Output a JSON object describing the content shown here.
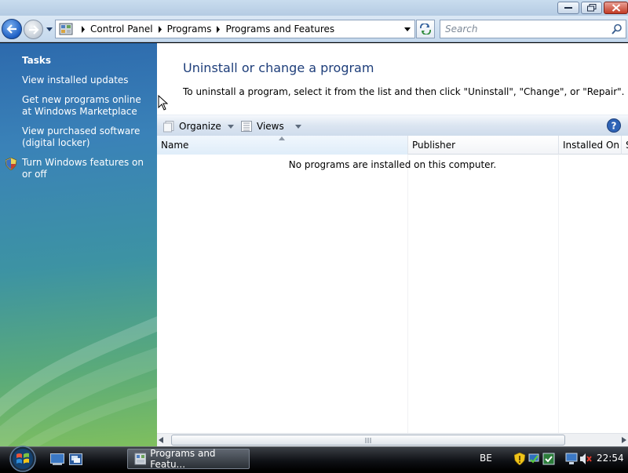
{
  "address_bar": {
    "breadcrumbs": [
      "Control Panel",
      "Programs",
      "Programs and Features"
    ],
    "search_placeholder": "Search"
  },
  "task_pane": {
    "heading": "Tasks",
    "links": [
      "View installed updates",
      "Get new programs online at Windows Marketplace",
      "View purchased software (digital locker)",
      "Turn Windows features on or off"
    ]
  },
  "main": {
    "title": "Uninstall or change a program",
    "description": "To uninstall a program, select it from the list and then click \"Uninstall\", \"Change\", or \"Repair\".",
    "toolbar": {
      "organize_label": "Organize",
      "views_label": "Views"
    },
    "columns": [
      "Name",
      "Publisher",
      "Installed On",
      "S"
    ],
    "empty_message": "No programs are installed on this computer."
  },
  "taskbar": {
    "window_button_label": "Programs and Featu...",
    "language": "BE",
    "clock": "22:54"
  },
  "colors": {
    "title_text": "#1e3e7a",
    "task_pane_top": "#2d6aad",
    "task_pane_bottom": "#7fbf5e"
  }
}
